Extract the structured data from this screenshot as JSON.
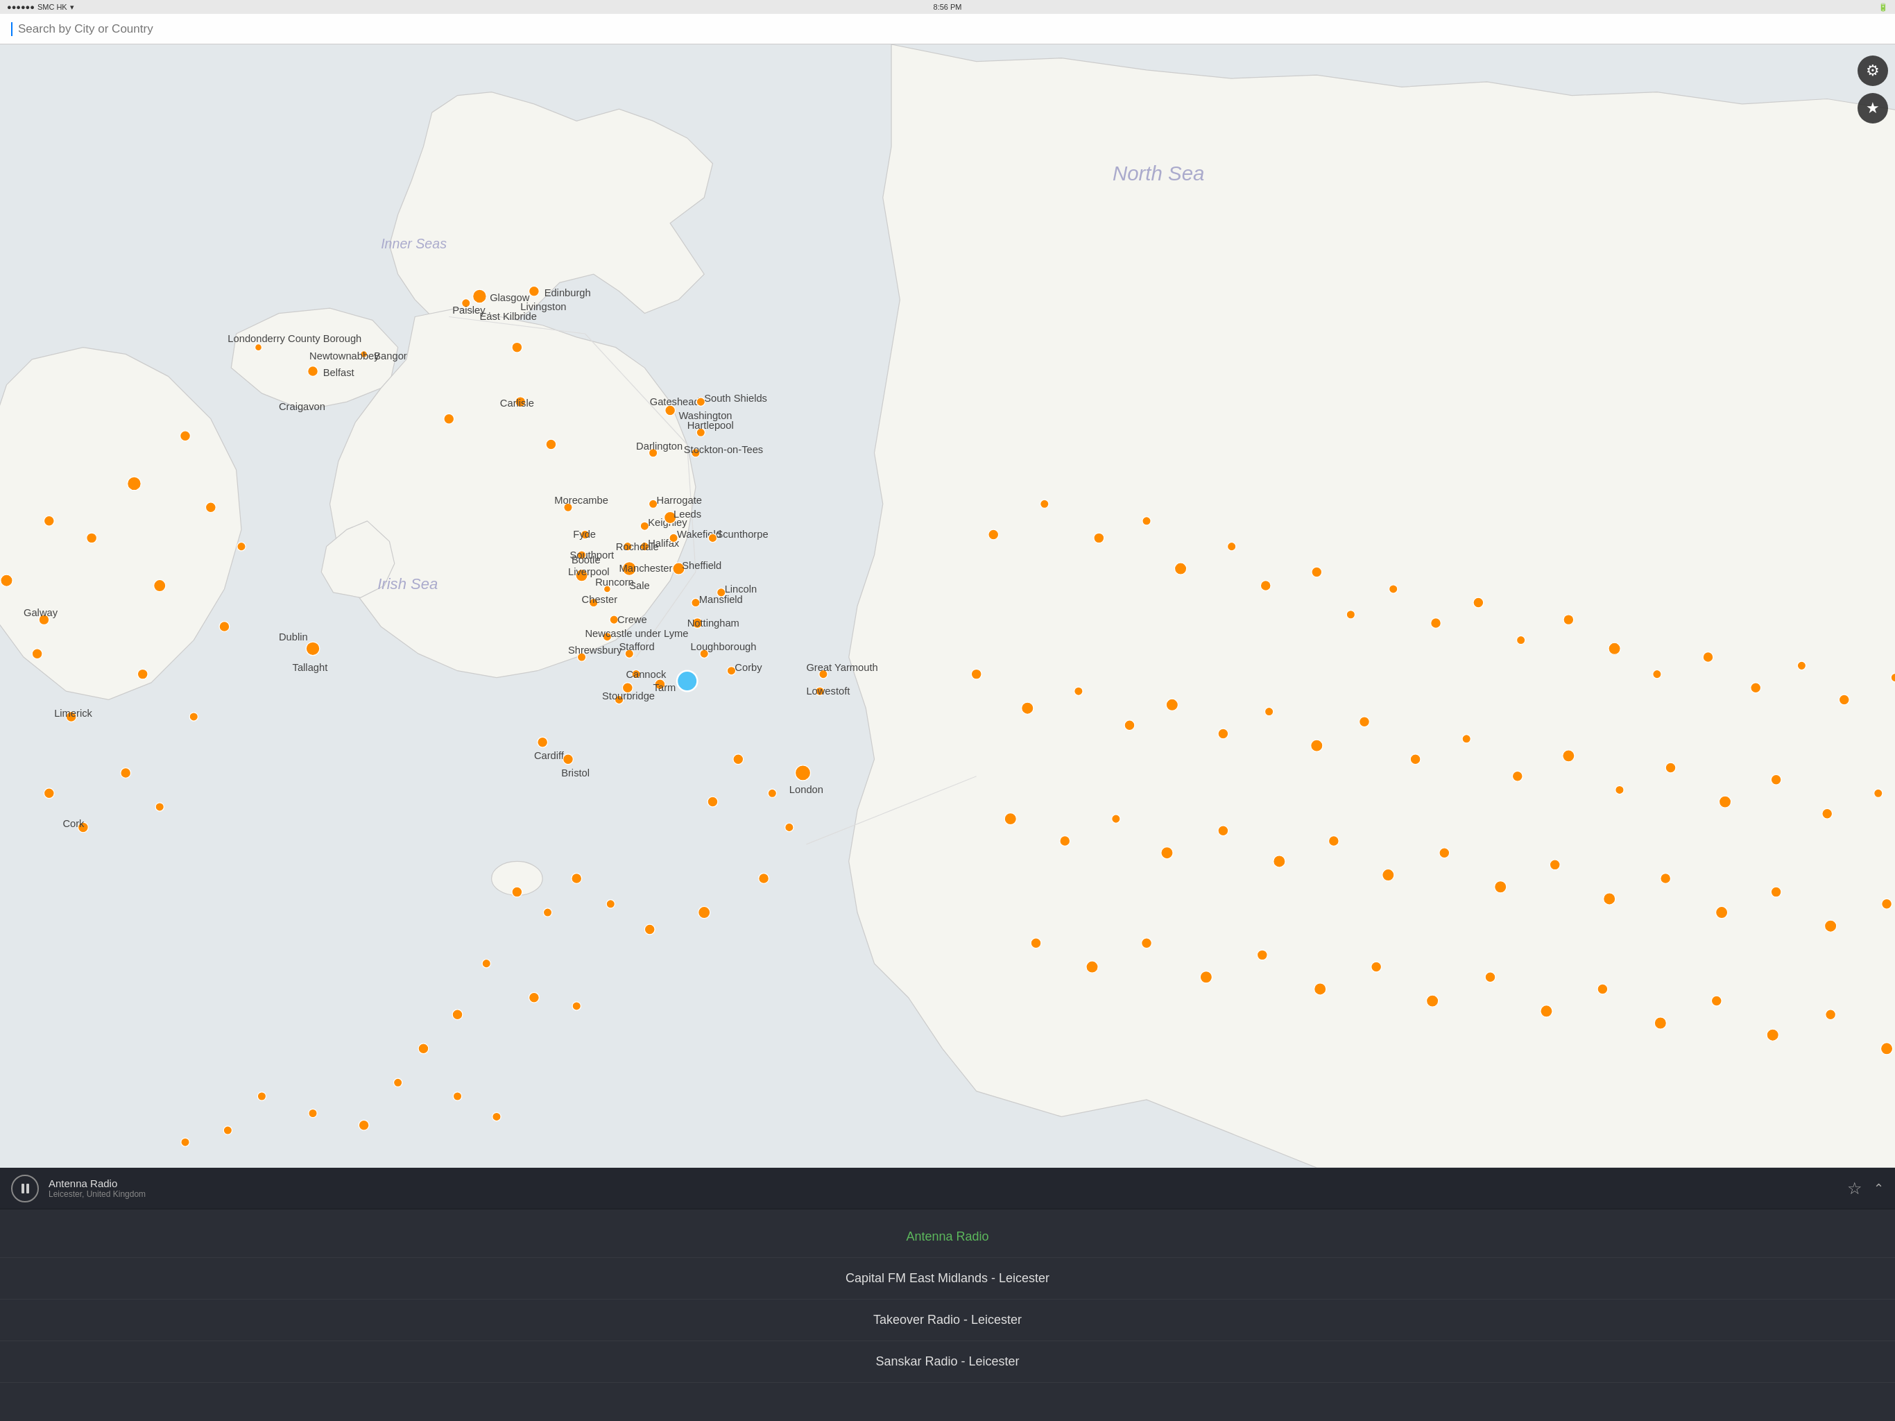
{
  "statusBar": {
    "carrier": "SMC HK",
    "time": "8:56 PM",
    "wifi": "wifi",
    "battery": "battery"
  },
  "search": {
    "placeholder": "Search by City or Country"
  },
  "map": {
    "gearButton": "⚙",
    "starButton": "★"
  },
  "nowPlaying": {
    "stationName": "Antenna Radio",
    "location": "Leicester, United Kingdom"
  },
  "stations": [
    {
      "name": "Antenna Radio",
      "active": true
    },
    {
      "name": "Capital FM East Midlands - Leicester",
      "active": false
    },
    {
      "name": "Takeover Radio - Leicester",
      "active": false
    },
    {
      "name": "Sanskar Radio - Leicester",
      "active": false
    }
  ],
  "actions": {
    "starLabel": "☆",
    "chevronLabel": "⌃"
  }
}
